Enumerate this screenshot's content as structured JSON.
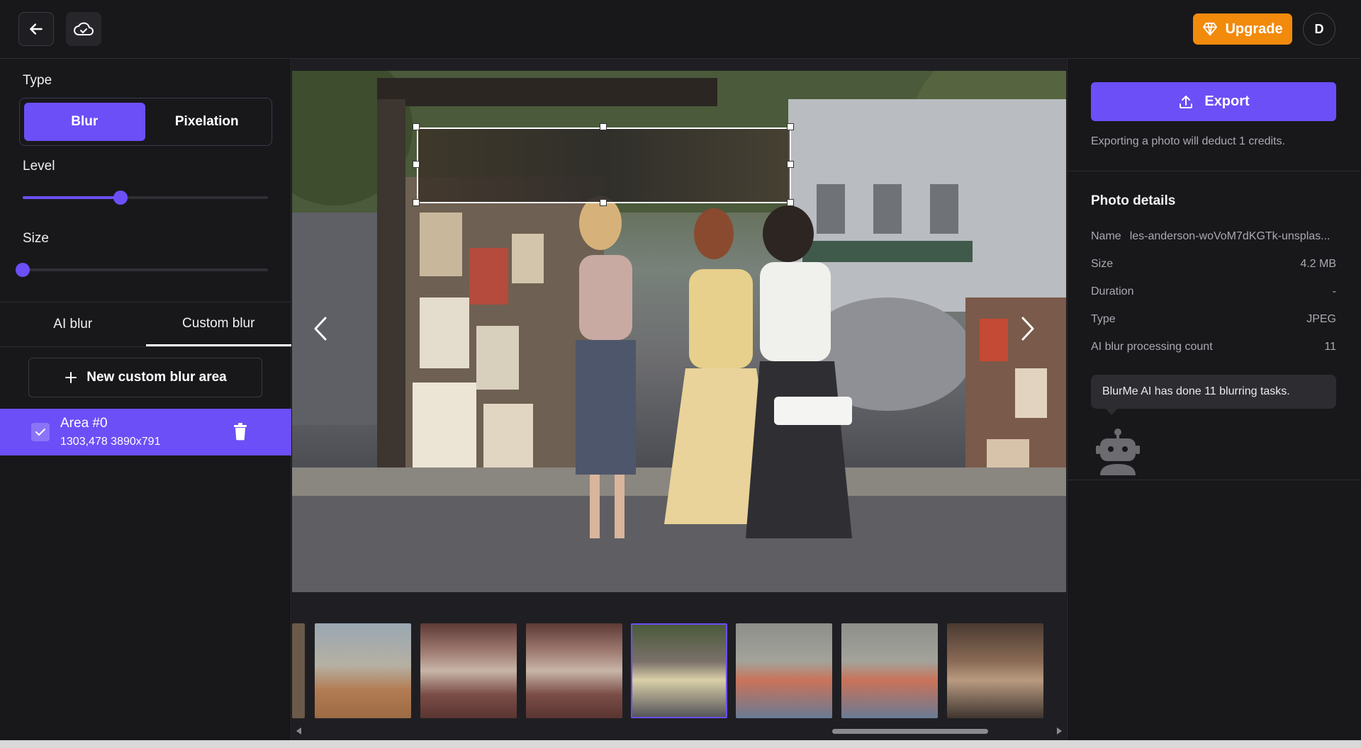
{
  "topbar": {
    "back_icon": "arrow-left-icon",
    "cloud_icon": "cloud-check-icon",
    "upgrade_label": "Upgrade",
    "upgrade_icon": "diamond-icon",
    "avatar_initial": "D"
  },
  "left": {
    "type_label": "Type",
    "type_options": [
      "Blur",
      "Pixelation"
    ],
    "type_selected": "Blur",
    "level_label": "Level",
    "level_value": 0.4,
    "size_label": "Size",
    "size_value": 0.0,
    "tabs": [
      "AI blur",
      "Custom blur"
    ],
    "tab_active": "Custom blur",
    "new_area_label": "New custom blur area",
    "areas": [
      {
        "title": "Area #0",
        "meta": "1303,478 3890x791",
        "checked": true
      }
    ]
  },
  "right": {
    "export_label": "Export",
    "export_note": "Exporting a photo will deduct 1 credits.",
    "details_title": "Photo details",
    "details": [
      {
        "key": "Name",
        "value": "les-anderson-woVoM7dKGTk-unsplas..."
      },
      {
        "key": "Size",
        "value": "4.2 MB"
      },
      {
        "key": "Duration",
        "value": "-"
      },
      {
        "key": "Type",
        "value": "JPEG"
      },
      {
        "key": "AI blur processing count",
        "value": "11"
      }
    ],
    "tooltip": "BlurMe AI has done 11 blurring tasks."
  },
  "colors": {
    "accent": "#6c4ff6",
    "upgrade": "#f28a0c",
    "background": "#18181b"
  }
}
